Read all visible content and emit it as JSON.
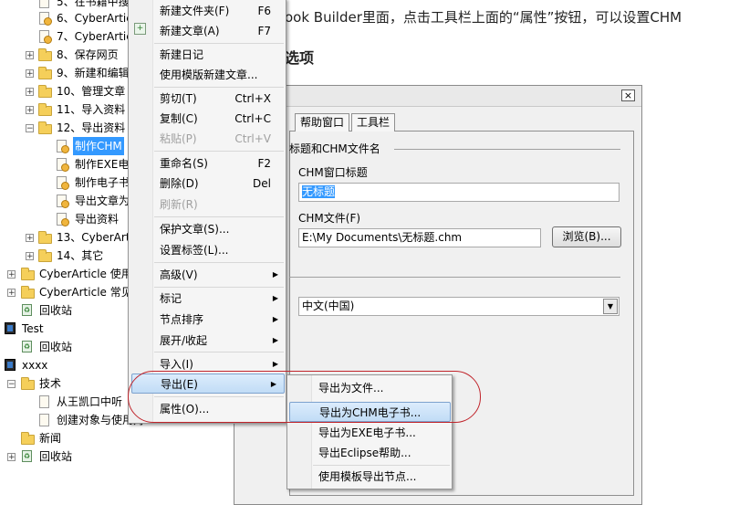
{
  "tree": {
    "rows": [
      {
        "label": "5、在书籍中搜"
      },
      {
        "label": "6、CyberArtic"
      },
      {
        "label": "7、CyberArtic"
      },
      {
        "label": "8、保存网页"
      },
      {
        "label": "9、新建和编辑"
      },
      {
        "label": "10、管理文章"
      },
      {
        "label": "11、导入资料"
      },
      {
        "label": "12、导出资料"
      },
      {
        "label": "制作CHM"
      },
      {
        "label": "制作EXE电"
      },
      {
        "label": "制作电子书"
      },
      {
        "label": "导出文章为"
      },
      {
        "label": "导出资料"
      },
      {
        "label": "13、CyberArt"
      },
      {
        "label": "14、其它"
      },
      {
        "label": "CyberArticle 使用"
      },
      {
        "label": "CyberArticle 常见"
      },
      {
        "label": "回收站"
      },
      {
        "label": "Test"
      },
      {
        "label": "回收站"
      },
      {
        "label": "xxxx"
      },
      {
        "label": "技术"
      },
      {
        "label": "从王凯口中听"
      },
      {
        "label": "创建对象与使用对"
      },
      {
        "label": "新闻"
      },
      {
        "label": "回收站"
      }
    ]
  },
  "article": {
    "line1": "ook Builder里面，点击工具栏上面的“属性”按钮，可以设置CHM",
    "heading": "选项"
  },
  "dialog": {
    "close": "×",
    "tabs": [
      "帮助窗口",
      "工具栏"
    ],
    "group1": "标题和CHM文件名",
    "chm_title_label": "CHM窗口标题",
    "chm_title_value": "无标题",
    "chm_file_label": "CHM文件(F)",
    "chm_file_value": "E:\\My Documents\\无标题.chm",
    "browse_button": "浏览(B)...",
    "language_value": "中文(中国)"
  },
  "context_menu": {
    "items": [
      {
        "label": "新建文件夹(F)",
        "shortcut": "F6"
      },
      {
        "label": "新建文章(A)",
        "shortcut": "F7"
      },
      {
        "label": "新建日记",
        "shortcut": ""
      },
      {
        "label": "使用模版新建文章...",
        "shortcut": ""
      },
      {
        "label": "剪切(T)",
        "shortcut": "Ctrl+X"
      },
      {
        "label": "复制(C)",
        "shortcut": "Ctrl+C"
      },
      {
        "label": "粘贴(P)",
        "shortcut": "Ctrl+V"
      },
      {
        "label": "重命名(S)",
        "shortcut": "F2"
      },
      {
        "label": "删除(D)",
        "shortcut": "Del"
      },
      {
        "label": "刷新(R)",
        "shortcut": ""
      },
      {
        "label": "保护文章(S)...",
        "shortcut": ""
      },
      {
        "label": "设置标签(L)...",
        "shortcut": ""
      },
      {
        "label": "高级(V)",
        "shortcut": ""
      },
      {
        "label": "标记",
        "shortcut": ""
      },
      {
        "label": "节点排序",
        "shortcut": ""
      },
      {
        "label": "展开/收起",
        "shortcut": ""
      },
      {
        "label": "导入(I)",
        "shortcut": ""
      },
      {
        "label": "导出(E)",
        "shortcut": ""
      },
      {
        "label": "属性(O)...",
        "shortcut": ""
      }
    ]
  },
  "export_submenu": {
    "items": [
      {
        "label": "导出为文件..."
      },
      {
        "label": "导出为CHM电子书..."
      },
      {
        "label": "导出为EXE电子书..."
      },
      {
        "label": "导出Eclipse帮助..."
      },
      {
        "label": "使用模板导出节点..."
      }
    ]
  },
  "colors": {
    "selection": "#3399ff",
    "menu_highlight": "#c1dcf6",
    "annotation_oval": "#c0242b"
  }
}
